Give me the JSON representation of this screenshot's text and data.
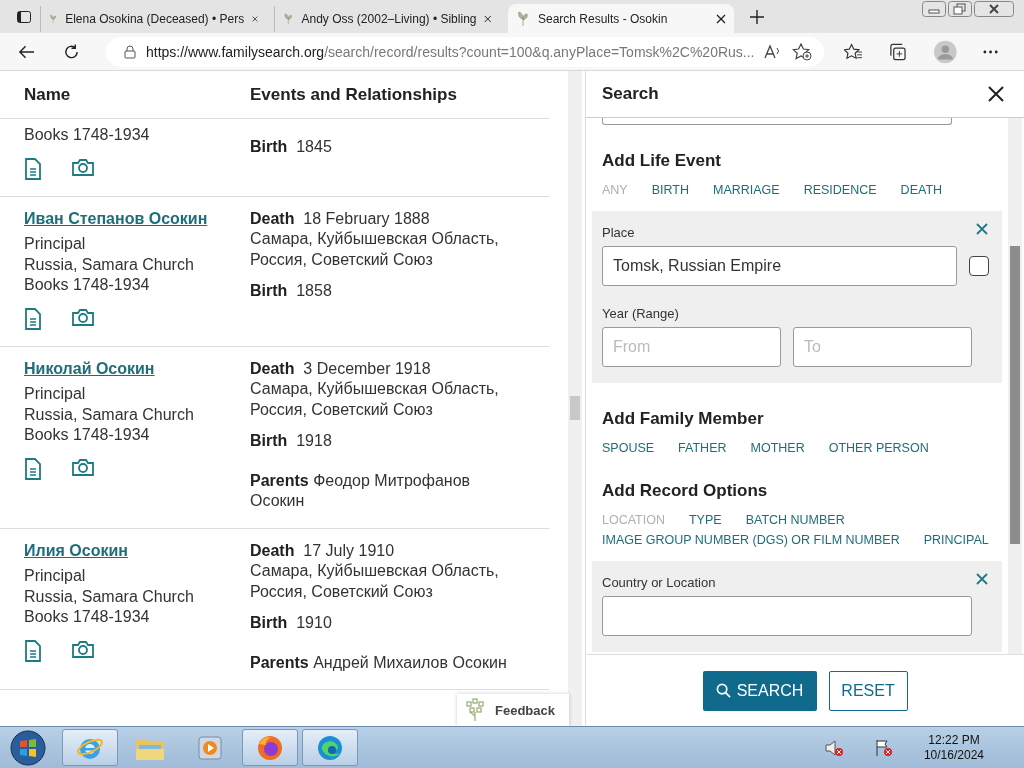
{
  "browser": {
    "tabs": [
      {
        "title": "Elena Osokina (Deceased) • Pers",
        "selected": false
      },
      {
        "title": "Andy Oss (2002–Living) • Sibling",
        "selected": false
      },
      {
        "title": "Search Results - Osokin",
        "selected": true
      }
    ],
    "url_host": "https://www.familysearch.org",
    "url_path": "/search/record/results?count=100&q.anyPlace=Tomsk%2C%20Rus..."
  },
  "results": {
    "columns": [
      "Name",
      "Events and Relationships"
    ],
    "rows": [
      {
        "lines": [
          "Books 1748-1934"
        ],
        "events": [
          {
            "label": "Birth",
            "value": "1845"
          }
        ]
      },
      {
        "name": "Иван Степанов Осокин",
        "lines": [
          "Principal",
          "Russia, Samara Church",
          "Books 1748-1934"
        ],
        "events": [
          {
            "label": "Death",
            "value": "18 February 1888",
            "place": "Самара, Куйбышевская Область, Россия, Советский Союз"
          },
          {
            "label": "Birth",
            "value": "1858"
          }
        ]
      },
      {
        "name": "Николай Осокин",
        "lines": [
          "Principal",
          "Russia, Samara Church",
          "Books 1748-1934"
        ],
        "events": [
          {
            "label": "Death",
            "value": "3 December 1918",
            "place": "Самара, Куйбышевская Область, Россия, Советский Союз"
          },
          {
            "label": "Birth",
            "value": "1918"
          }
        ],
        "parents_label": "Parents",
        "parents": "Феодор Митрофанов Осокин"
      },
      {
        "name": "Илия Осокин",
        "lines": [
          "Principal",
          "Russia, Samara Church",
          "Books 1748-1934"
        ],
        "events": [
          {
            "label": "Death",
            "value": "17 July 1910",
            "place": "Самара, Куйбышевская Область, Россия, Советский Союз"
          },
          {
            "label": "Birth",
            "value": "1910"
          }
        ],
        "parents_label": "Parents",
        "parents": "Андрей Михаилов Осокин"
      }
    ],
    "feedback": "Feedback"
  },
  "search_panel": {
    "title": "Search",
    "life_event": {
      "heading": "Add Life Event",
      "options": [
        {
          "label": "ANY",
          "disabled": true
        },
        {
          "label": "BIRTH",
          "disabled": false
        },
        {
          "label": "MARRIAGE",
          "disabled": false
        },
        {
          "label": "RESIDENCE",
          "disabled": false
        },
        {
          "label": "DEATH",
          "disabled": false
        }
      ],
      "place_label": "Place",
      "place_value": "Tomsk, Russian Empire",
      "exact": false,
      "year_label": "Year (Range)",
      "from_placeholder": "From",
      "to_placeholder": "To"
    },
    "family": {
      "heading": "Add Family Member",
      "options": [
        {
          "label": "SPOUSE",
          "disabled": false
        },
        {
          "label": "FATHER",
          "disabled": false
        },
        {
          "label": "MOTHER",
          "disabled": false
        },
        {
          "label": "OTHER PERSON",
          "disabled": false
        }
      ]
    },
    "record": {
      "heading": "Add Record Options",
      "options": [
        {
          "label": "LOCATION",
          "disabled": true
        },
        {
          "label": "TYPE",
          "disabled": false
        },
        {
          "label": "BATCH NUMBER",
          "disabled": false
        },
        {
          "label": "IMAGE GROUP NUMBER (DGS) OR FILM NUMBER",
          "disabled": false
        },
        {
          "label": "PRINCIPAL",
          "disabled": false
        }
      ],
      "location_label": "Country or Location"
    },
    "search_button": "SEARCH",
    "reset_button": "RESET"
  },
  "taskbar": {
    "apps": [
      {
        "kind": "ie",
        "open": true
      },
      {
        "kind": "folder",
        "open": false
      },
      {
        "kind": "media",
        "open": false
      },
      {
        "kind": "firefox",
        "open": true
      },
      {
        "kind": "edge",
        "open": true
      }
    ],
    "time": "12:22 PM",
    "date": "10/16/2024"
  }
}
